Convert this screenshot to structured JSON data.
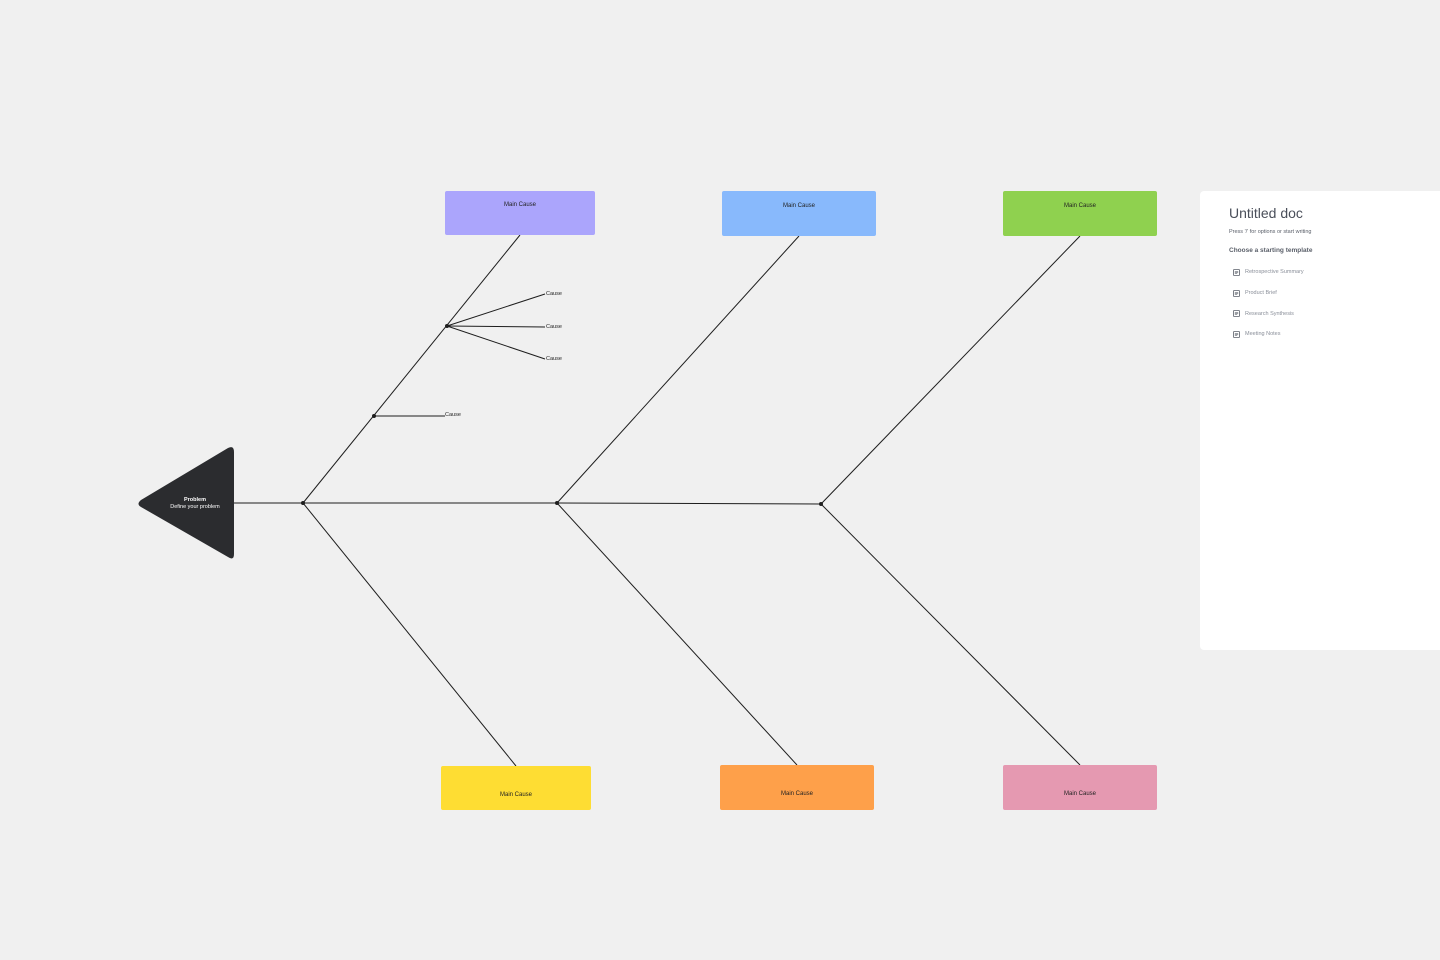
{
  "problem": {
    "title": "Problem",
    "subtitle": "Define your problem",
    "color": "#2b2c2f"
  },
  "main_causes": {
    "top": [
      {
        "label": "Main Cause",
        "color": "#aba5fc"
      },
      {
        "label": "Main Cause",
        "color": "#88b9fc"
      },
      {
        "label": "Main Cause",
        "color": "#8fd14f"
      }
    ],
    "bottom": [
      {
        "label": "Main Cause",
        "color": "#fedd33"
      },
      {
        "label": "Main Cause",
        "color": "#fea04a"
      },
      {
        "label": "Main Cause",
        "color": "#e599b1"
      }
    ]
  },
  "sub_causes": [
    "Cause",
    "Cause",
    "Cause",
    "Cause"
  ],
  "doc": {
    "title": "Untitled doc",
    "hint": "Press '/' for options or start writing",
    "section_heading": "Choose a starting template",
    "templates": [
      {
        "label": "Retrospective Summary",
        "icon": "doc-icon"
      },
      {
        "label": "Product Brief",
        "icon": "doc-icon"
      },
      {
        "label": "Research Synthesis",
        "icon": "doc-icon"
      },
      {
        "label": "Meeting Notes",
        "icon": "doc-icon"
      }
    ]
  }
}
